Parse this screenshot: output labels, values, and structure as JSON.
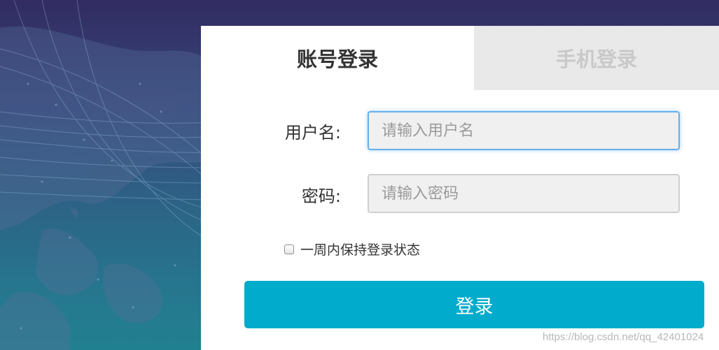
{
  "tabs": {
    "account_login": "账号登录",
    "phone_login": "手机登录"
  },
  "form": {
    "username_label": "用户名:",
    "username_placeholder": "请输入用户名",
    "password_label": "密码:",
    "password_placeholder": "请输入密码",
    "remember_label": "一周内保持登录状态",
    "remember_checked": false,
    "submit_label": "登录"
  },
  "watermark": "https://blog.csdn.net/qq_42401024",
  "colors": {
    "accent": "#00abcb",
    "focus_border": "#66afe9",
    "inactive_tab_bg": "#e9e9e9"
  }
}
